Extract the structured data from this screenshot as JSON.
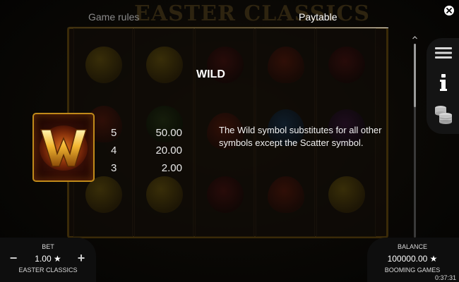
{
  "background": {
    "game_title": "EASTER CLASSICS"
  },
  "tabs": {
    "rules_label": "Game rules",
    "paytable_label": "Paytable"
  },
  "paytable": {
    "section_title": "WILD",
    "symbol_icon": "wild-w-icon",
    "rows": [
      {
        "count": "5",
        "value": "50.00"
      },
      {
        "count": "4",
        "value": "20.00"
      },
      {
        "count": "3",
        "value": "2.00"
      }
    ],
    "description": "The Wild symbol substitutes for all other symbols except the Scatter symbol."
  },
  "side_menu": {
    "items": [
      "menu-icon",
      "info-icon",
      "coins-icon"
    ]
  },
  "footer": {
    "bet_label": "BET",
    "bet_value": "1.00 ★",
    "minus": "−",
    "plus": "+",
    "game_name": "EASTER CLASSICS",
    "balance_label": "BALANCE",
    "balance_value": "100000.00 ★",
    "provider": "BOOMING GAMES",
    "clock": "0:37:31"
  },
  "colors": {
    "accent_gold": "#c08a1a",
    "panel": "#141414",
    "text": "#ffffff"
  }
}
